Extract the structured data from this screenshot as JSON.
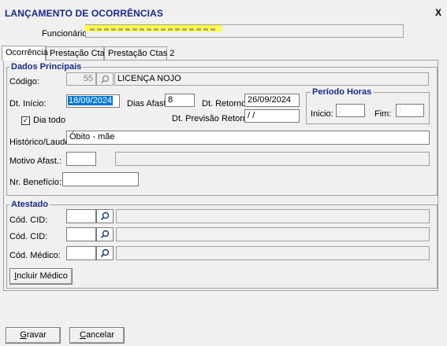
{
  "window": {
    "title": "LANÇAMENTO DE OCORRÊNCIAS",
    "close_label": "X"
  },
  "funcionario": {
    "label": "Funcionário:",
    "value": ""
  },
  "tabs": [
    {
      "label": "Ocorrência",
      "active": true
    },
    {
      "label": "Prestação Ctas",
      "active": false
    },
    {
      "label": "Prestação Ctas 2",
      "active": false
    }
  ],
  "dados_principais": {
    "title": "Dados Principais",
    "codigo_label": "Código:",
    "codigo_value": "55",
    "codigo_desc": "LICENÇA NOJO",
    "dt_inicio_label": "Dt. Início:",
    "dt_inicio_value": "18/09/2024",
    "dias_afast_label": "Dias Afast.",
    "dias_afast_value": "8",
    "dt_retorno_label": "Dt. Retorno:",
    "dt_retorno_value": "26/09/2024",
    "dia_todo_label": "Dia todo",
    "dia_todo_checked": true,
    "dt_prev_retorno_label": "Dt. Previsão Retorno:",
    "dt_prev_retorno_value": " / /",
    "periodo_horas": {
      "title": "Período Horas",
      "inicio_label": "Inicio:",
      "inicio_value": ":",
      "fim_label": "Fim:",
      "fim_value": ":"
    },
    "historico_label": "Histórico/Laudo:",
    "historico_value": "Óbito - mãe",
    "motivo_label": "Motivo Afast.:",
    "motivo_value": "",
    "motivo_desc": "",
    "beneficio_label": "Nr. Benefício:",
    "beneficio_value": ""
  },
  "atestado": {
    "title": "Atestado",
    "rows": [
      {
        "label": "Cód. CID:",
        "value": "",
        "desc": ""
      },
      {
        "label": "Cód. CID:",
        "value": "",
        "desc": ""
      },
      {
        "label": "Cód. Médico:",
        "value": "",
        "desc": ""
      }
    ],
    "incluir_medico": {
      "underline": "I",
      "rest": "ncluir Médico"
    }
  },
  "buttons": {
    "gravar": {
      "underline": "G",
      "rest": "ravar"
    },
    "cancelar": {
      "underline": "C",
      "rest": "ancelar"
    }
  },
  "colors": {
    "title_blue": "#1a2a8a",
    "selection_blue": "#0078d7",
    "highlight_yellow": "#ffff33"
  }
}
